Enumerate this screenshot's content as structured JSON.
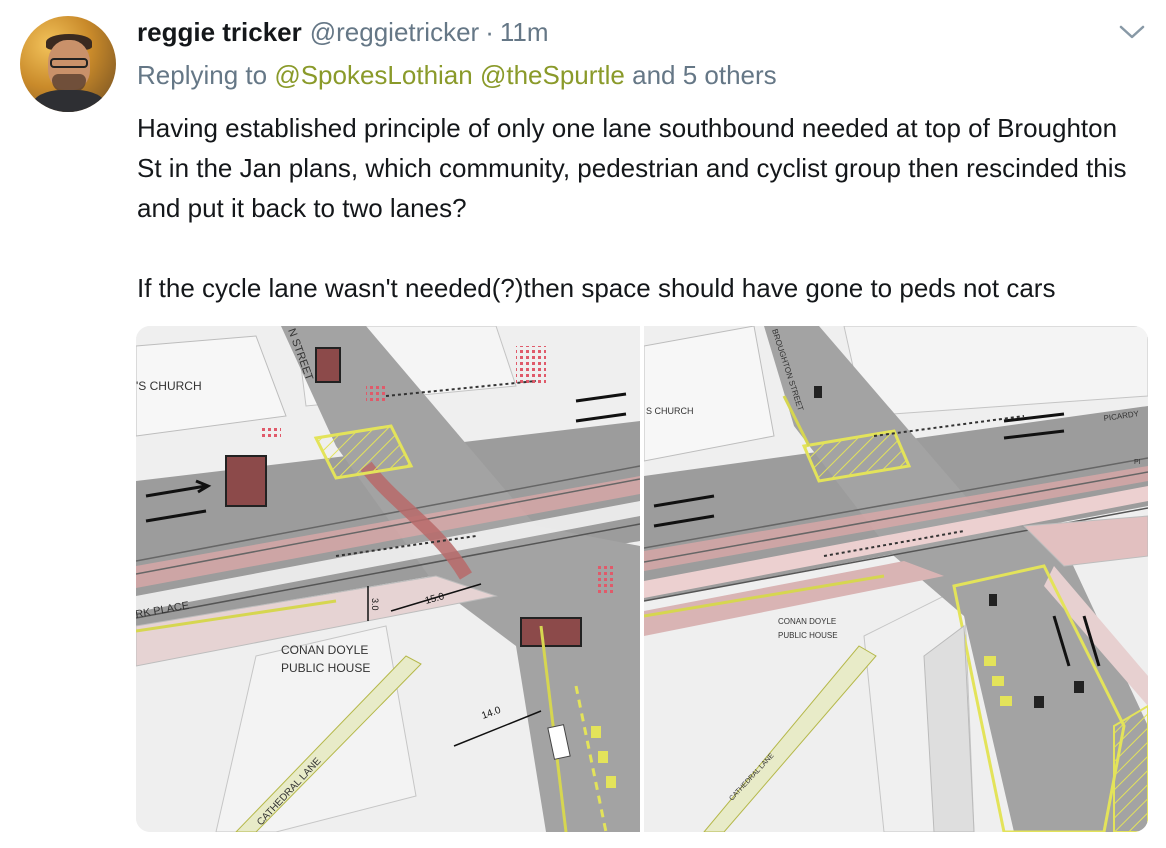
{
  "tweet": {
    "display_name": "reggie tricker",
    "handle": "@reggietricker",
    "separator": "·",
    "time": "11m",
    "reply_prefix": "Replying to",
    "reply_mentions": [
      "@SpokesLothian",
      "@theSpurtle"
    ],
    "reply_suffix": "and 5 others",
    "body": [
      "Having established principle of only one lane southbound needed at top of Broughton St in the Jan plans, which community, pedestrian and cyclist group then rescinded this and put it back to two lanes?",
      "If the cycle lane wasn't needed(?)then space should have gone to peds not cars"
    ],
    "icons": {
      "menu": "chevron-down-icon"
    }
  },
  "media": {
    "left": {
      "labels": {
        "church": "'S CHURCH",
        "street": "N STREET",
        "place": "RK PLACE",
        "pub_line1": "CONAN DOYLE",
        "pub_line2": "PUBLIC HOUSE",
        "lane": "CATHEDRAL LANE",
        "dim_3": "3.0",
        "dim_15": "15.0",
        "dim_14": "14.0"
      }
    },
    "right": {
      "labels": {
        "church": "S CHURCH",
        "street": "BROUGHTON STREET",
        "pub_line1": "CONAN DOYLE",
        "pub_line2": "PUBLIC HOUSE",
        "lane": "CATHEDRAL LANE",
        "picardy": "PICARDY",
        "pi": "PI"
      }
    }
  },
  "colors": {
    "road_gray": "#9c9c9c",
    "pavement": "#e4e4e4",
    "cycle_pink": "#d9a7a7",
    "cycle_red": "#b86a6a",
    "hatch_yellow": "#e3e35a",
    "mention": "#8a9a2a",
    "meta_gray": "#657786"
  }
}
